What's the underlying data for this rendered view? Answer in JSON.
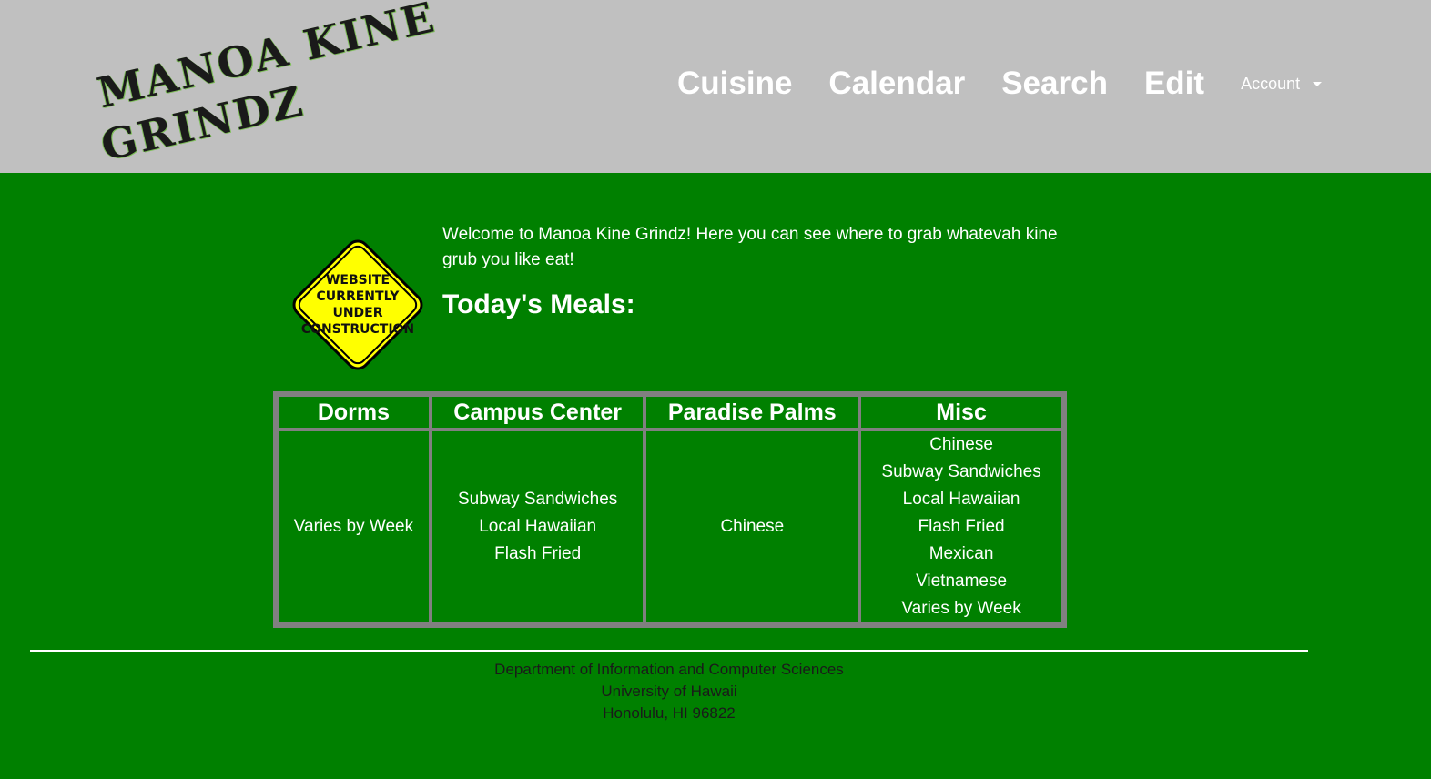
{
  "navbar": {
    "logo": {
      "line1": "MANOA KINE",
      "line2": "GRINDZ"
    },
    "links": [
      "Cuisine",
      "Calendar",
      "Search",
      "Edit"
    ],
    "account_label": "Account"
  },
  "colors": {
    "page_background": "#008000",
    "navbar_background": "#c0c0c0",
    "sign_yellow": "#ffff00",
    "table_border": "#808080"
  },
  "sign": {
    "lines": [
      "WEBSITE",
      "CURRENTLY",
      "UNDER",
      "CONSTRUCTION"
    ]
  },
  "main": {
    "welcome": "Welcome to Manoa Kine Grindz! Here you can see where to grab whatevah kine grub you like eat!",
    "meals_title": "Today's Meals:"
  },
  "table": {
    "columns": [
      {
        "header": "Dorms",
        "items": [
          "Varies by Week"
        ]
      },
      {
        "header": "Campus Center",
        "items": [
          "Subway Sandwiches",
          "Local Hawaiian",
          "Flash Fried"
        ]
      },
      {
        "header": "Paradise Palms",
        "items": [
          "Chinese"
        ]
      },
      {
        "header": "Misc",
        "items": [
          "Chinese",
          "Subway Sandwiches",
          "Local Hawaiian",
          "Flash Fried",
          "Mexican",
          "Vietnamese",
          "Varies by Week"
        ]
      }
    ]
  },
  "footer": {
    "lines": [
      "Department of Information and Computer Sciences",
      "University of Hawaii",
      "Honolulu, HI 96822"
    ]
  }
}
